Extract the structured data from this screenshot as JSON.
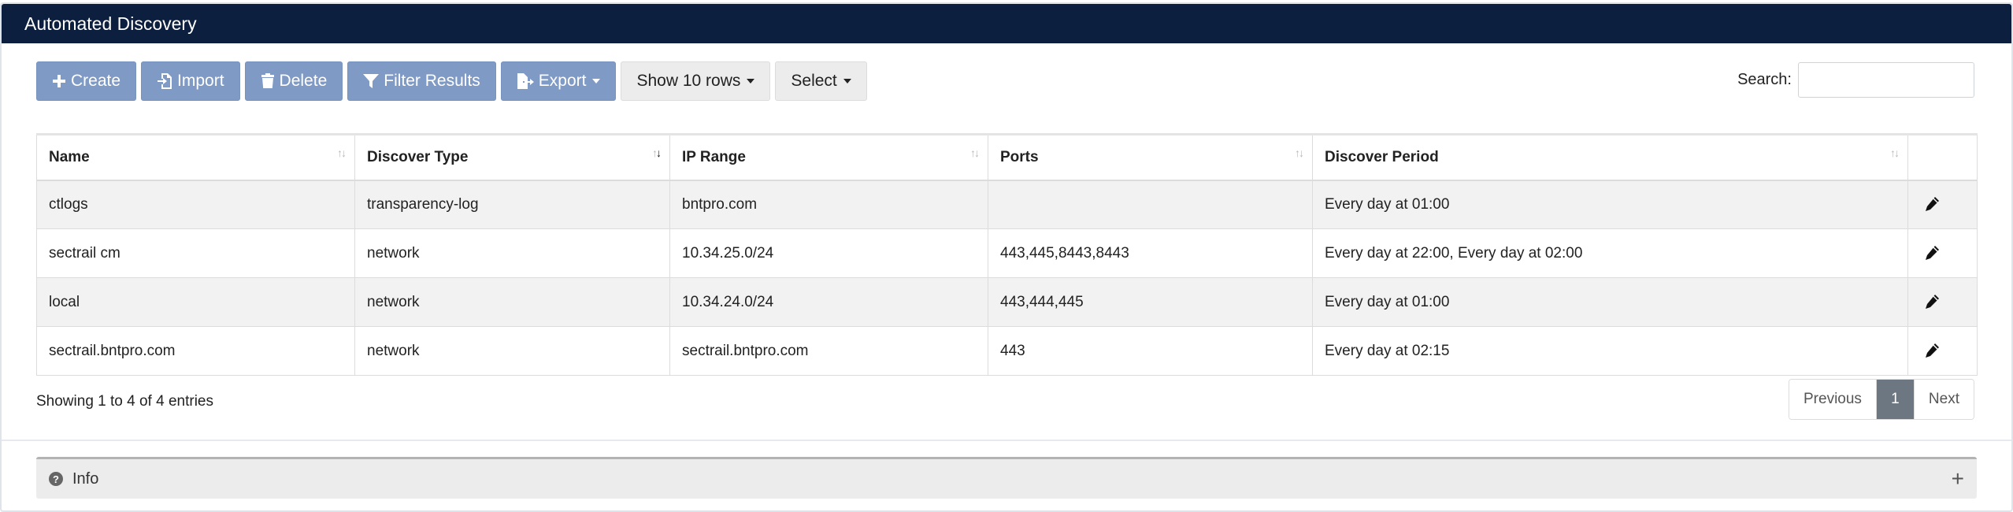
{
  "panel": {
    "title": "Automated Discovery"
  },
  "toolbar": {
    "create_label": "Create",
    "import_label": "Import",
    "delete_label": "Delete",
    "filter_label": "Filter Results",
    "export_label": "Export",
    "show_rows_label": "Show 10 rows",
    "select_label": "Select"
  },
  "search": {
    "label": "Search:",
    "value": "",
    "placeholder": ""
  },
  "table": {
    "columns": [
      "Name",
      "Discover Type",
      "IP Range",
      "Ports",
      "Discover Period"
    ],
    "sorted_column": "Discover Type",
    "rows": [
      {
        "name": "ctlogs",
        "type": "transparency-log",
        "ip_range": "bntpro.com",
        "ports": "",
        "period": "Every day at 01:00"
      },
      {
        "name": "sectrail cm",
        "type": "network",
        "ip_range": "10.34.25.0/24",
        "ports": "443,445,8443,8443",
        "period": "Every day at 22:00, Every day at 02:00"
      },
      {
        "name": "local",
        "type": "network",
        "ip_range": "10.34.24.0/24",
        "ports": "443,444,445",
        "period": "Every day at 01:00"
      },
      {
        "name": "sectrail.bntpro.com",
        "type": "network",
        "ip_range": "sectrail.bntpro.com",
        "ports": "443",
        "period": "Every day at 02:15"
      }
    ]
  },
  "footer": {
    "info": "Showing 1 to 4 of 4 entries"
  },
  "pagination": {
    "previous": "Previous",
    "current": "1",
    "next": "Next"
  },
  "info_section": {
    "label": "Info"
  },
  "icons": {
    "create": "plus-icon",
    "import": "file-import-icon",
    "delete": "trash-icon",
    "filter": "filter-icon",
    "export": "file-export-icon",
    "edit": "pencil-icon",
    "info": "question-circle-icon",
    "expand": "plus-icon"
  },
  "colors": {
    "header": "#0c1f3f",
    "primary_button": "#7f9ac4",
    "active_page": "#6d7781"
  }
}
